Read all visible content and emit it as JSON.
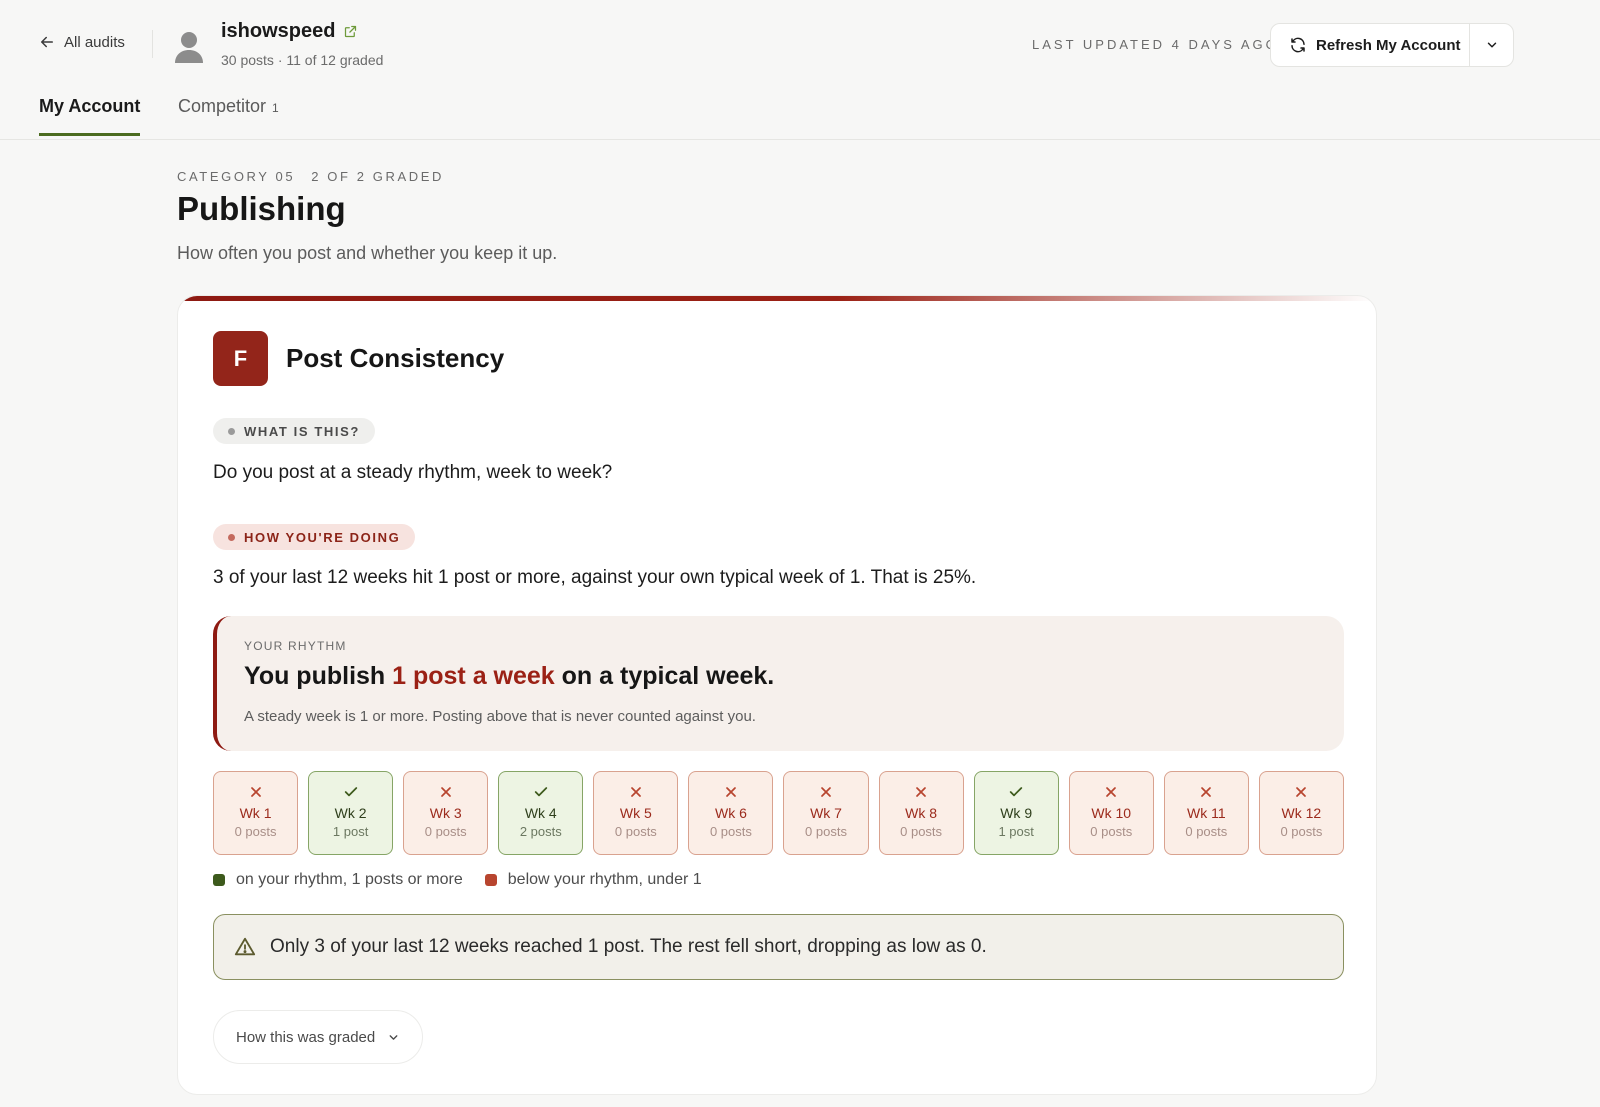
{
  "header": {
    "back_label": "All audits",
    "account_name": "ishowspeed",
    "account_meta": "30 posts · 11 of 12 graded",
    "last_updated": "Last updated 4 days ago",
    "refresh_label": "Refresh My Account"
  },
  "tabs": [
    {
      "label": "My Account",
      "active": true
    },
    {
      "label": "Competitor",
      "count": "1",
      "active": false
    }
  ],
  "category": {
    "number": "Category 05",
    "graded": "2 of 2 graded",
    "title": "Publishing",
    "subtitle": "How often you post and whether you keep it up."
  },
  "card": {
    "grade": "F",
    "title": "Post Consistency",
    "what_label": "What is this?",
    "question": "Do you post at a steady rhythm, week to week?",
    "how_label": "How you're doing",
    "how_text": "3 of your last 12 weeks hit 1 post or more, against your own typical week of 1. That is 25%.",
    "rhythm": {
      "label": "Your rhythm",
      "head_pre": "You publish ",
      "head_highlight": "1 post a week",
      "head_post": " on a typical week.",
      "note": "A steady week is 1 or more. Posting above that is never counted against you."
    },
    "weeks": [
      {
        "label": "Wk 1",
        "posts": "0 posts",
        "hit": false
      },
      {
        "label": "Wk 2",
        "posts": "1 post",
        "hit": true
      },
      {
        "label": "Wk 3",
        "posts": "0 posts",
        "hit": false
      },
      {
        "label": "Wk 4",
        "posts": "2 posts",
        "hit": true
      },
      {
        "label": "Wk 5",
        "posts": "0 posts",
        "hit": false
      },
      {
        "label": "Wk 6",
        "posts": "0 posts",
        "hit": false
      },
      {
        "label": "Wk 7",
        "posts": "0 posts",
        "hit": false
      },
      {
        "label": "Wk 8",
        "posts": "0 posts",
        "hit": false
      },
      {
        "label": "Wk 9",
        "posts": "1 post",
        "hit": true
      },
      {
        "label": "Wk 10",
        "posts": "0 posts",
        "hit": false
      },
      {
        "label": "Wk 11",
        "posts": "0 posts",
        "hit": false
      },
      {
        "label": "Wk 12",
        "posts": "0 posts",
        "hit": false
      }
    ],
    "legend": {
      "on": "on your rhythm, 1 posts or more",
      "below": "below your rhythm, under 1"
    },
    "warning": "Only 3 of your last 12 weeks reached 1 post. The rest fell short, dropping as low as 0.",
    "graded_toggle": "How this was graded"
  },
  "colors": {
    "accent_red": "#93251a",
    "accent_green": "#4b6b1f",
    "hit_green": "#3d5a1c",
    "miss_red": "#b8452f"
  }
}
